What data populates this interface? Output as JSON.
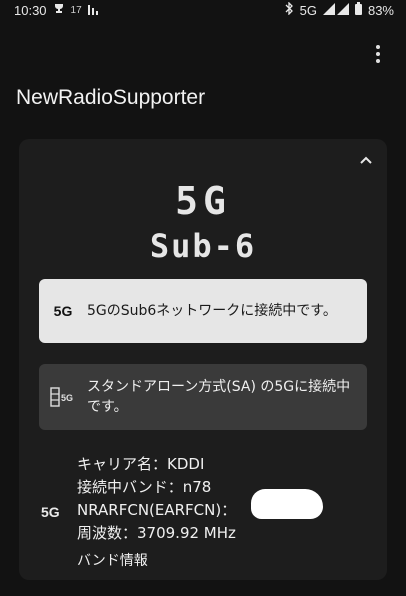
{
  "status_bar": {
    "time": "10:30",
    "temperature": "17",
    "network": "5G",
    "battery": "83%",
    "icons": [
      "trophy-icon",
      "signal-bars-icon",
      "bluetooth-icon",
      "cell-signal-icon",
      "battery-icon"
    ]
  },
  "app": {
    "title": "NewRadioSupporter"
  },
  "card": {
    "big_network": "5G",
    "big_band": "Sub-6",
    "connected_icon_label": "5G",
    "connected_message": "5GのSub6ネットワークに接続中です。",
    "sa_message": "スタンドアローン方式(SA) の5Gに接続中です。",
    "info_icon_label": "5G",
    "carrier_line": "キャリア名：KDDI",
    "band_line": "接続中バンド：n78",
    "nrarfcn_line": "NRARFCN(EARFCN)：",
    "frequency_line": "周波数：3709.92 MHz",
    "band_info_link": "バンド情報"
  },
  "colors": {
    "background": "#121212",
    "card": "#1d1d1d",
    "connected_box": "#e6e6e6",
    "sa_box": "#3a3a3a"
  }
}
